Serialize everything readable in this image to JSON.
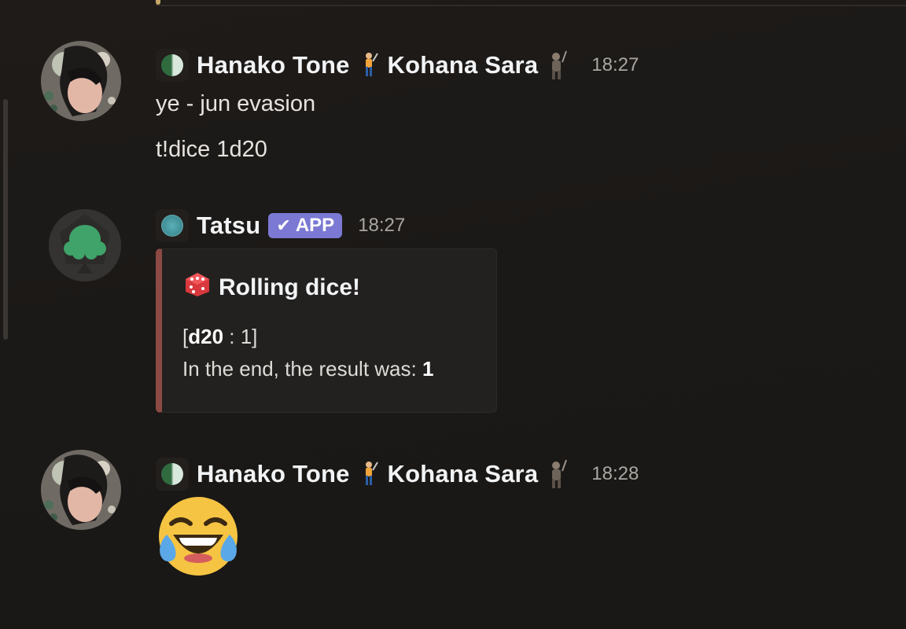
{
  "messages": [
    {
      "author": "Hanako Tone",
      "author_alt": "Kohana Sara",
      "time": "18:27",
      "lines": [
        "ye - jun evasion",
        "t!dice 1d20"
      ]
    },
    {
      "author": "Tatsu",
      "badge": "APP",
      "time": "18:27",
      "embed": {
        "title": "Rolling dice!",
        "roll_open": "[",
        "roll_die": "d20",
        "roll_rest": " : 1]",
        "result_prefix": "In the end, the result was: ",
        "result_value": "1"
      }
    },
    {
      "author": "Hanako Tone",
      "author_alt": "Kohana Sara",
      "time": "18:28",
      "emoji": "laughing-crying-face"
    }
  ],
  "colors": {
    "background": "#1c1a18",
    "embed_accent": "#8c4a44",
    "app_badge": "#7b79d3"
  }
}
